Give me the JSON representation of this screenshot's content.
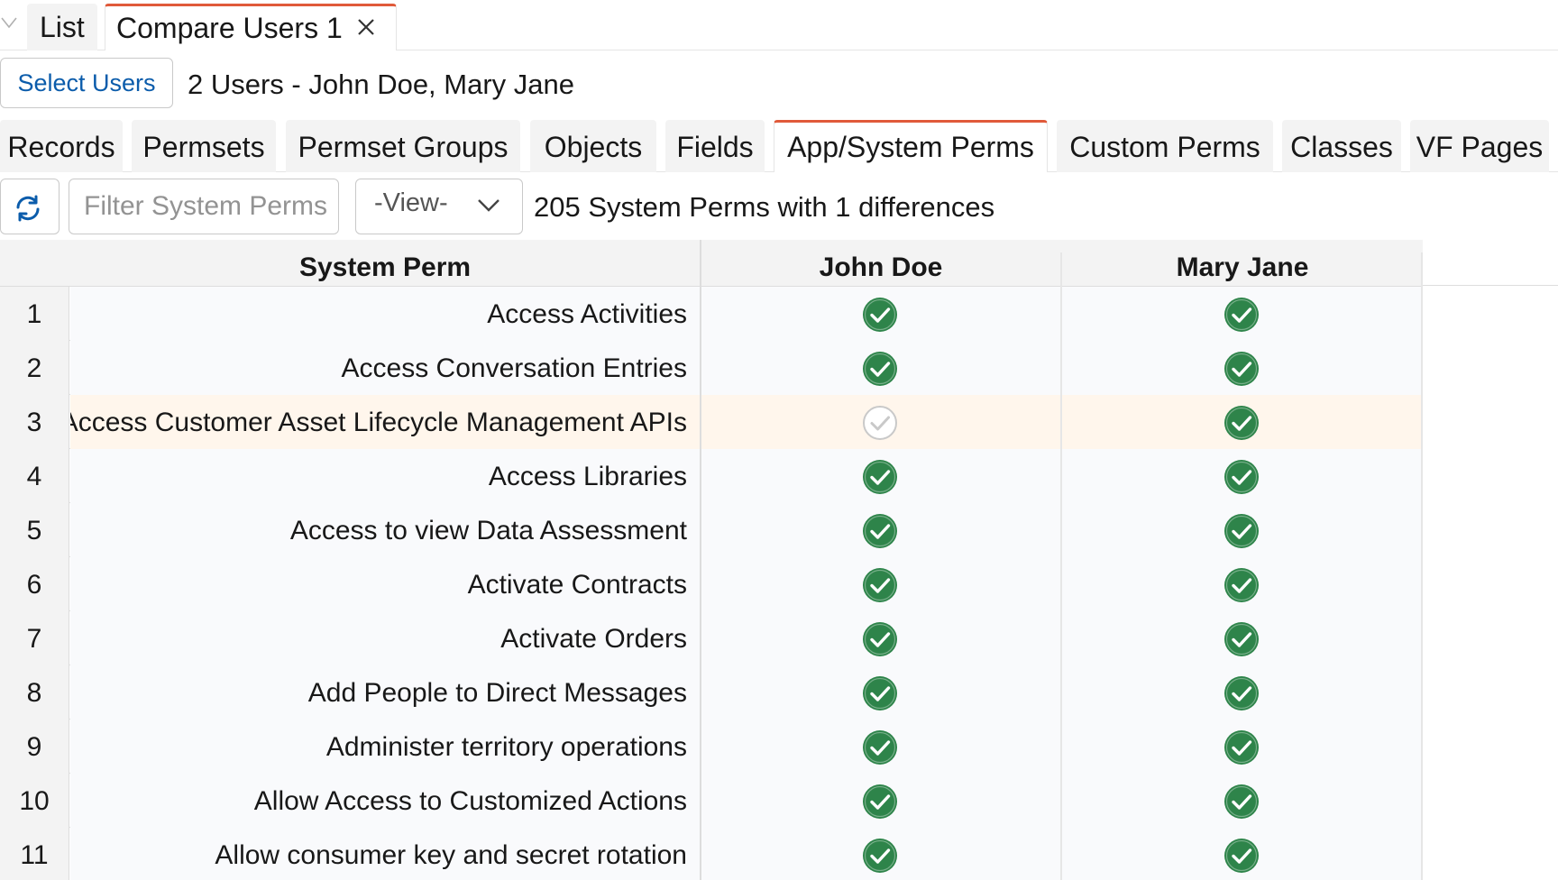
{
  "top_tabs": {
    "list_label": "List",
    "active_label": "Compare Users 1"
  },
  "select_users": {
    "button_label": "Select Users",
    "summary": "2 Users - John Doe, Mary Jane"
  },
  "sub_tabs": [
    {
      "label": "Records"
    },
    {
      "label": "Permsets"
    },
    {
      "label": "Permset Groups"
    },
    {
      "label": "Objects"
    },
    {
      "label": "Fields"
    },
    {
      "label": "App/System Perms",
      "active": true
    },
    {
      "label": "Custom Perms"
    },
    {
      "label": "Classes"
    },
    {
      "label": "VF Pages"
    }
  ],
  "toolbar": {
    "filter_placeholder": "Filter System Perms",
    "view_value": "-View-",
    "count_text": "205 System Perms with 1 differences"
  },
  "grid": {
    "columns": [
      "System Perm",
      "John Doe",
      "Mary Jane"
    ],
    "rows": [
      {
        "num": "1",
        "perm": "Access Activities",
        "john": "check",
        "mary": "check"
      },
      {
        "num": "2",
        "perm": "Access Conversation Entries",
        "john": "check",
        "mary": "check"
      },
      {
        "num": "3",
        "perm": "Access Customer Asset Lifecycle Management APIs",
        "john": "uncheck",
        "mary": "check",
        "diff": true
      },
      {
        "num": "4",
        "perm": "Access Libraries",
        "john": "check",
        "mary": "check"
      },
      {
        "num": "5",
        "perm": "Access to view Data Assessment",
        "john": "check",
        "mary": "check"
      },
      {
        "num": "6",
        "perm": "Activate Contracts",
        "john": "check",
        "mary": "check"
      },
      {
        "num": "7",
        "perm": "Activate Orders",
        "john": "check",
        "mary": "check"
      },
      {
        "num": "8",
        "perm": "Add People to Direct Messages",
        "john": "check",
        "mary": "check"
      },
      {
        "num": "9",
        "perm": "Administer territory operations",
        "john": "check",
        "mary": "check"
      },
      {
        "num": "10",
        "perm": "Allow Access to Customized Actions",
        "john": "check",
        "mary": "check"
      },
      {
        "num": "11",
        "perm": "Allow consumer key and secret rotation",
        "john": "check",
        "mary": "check"
      }
    ]
  },
  "colors": {
    "accent": "#e05a3a",
    "link": "#0b5cab",
    "check_green": "#2e844a",
    "diff_row": "#fff6ec"
  }
}
